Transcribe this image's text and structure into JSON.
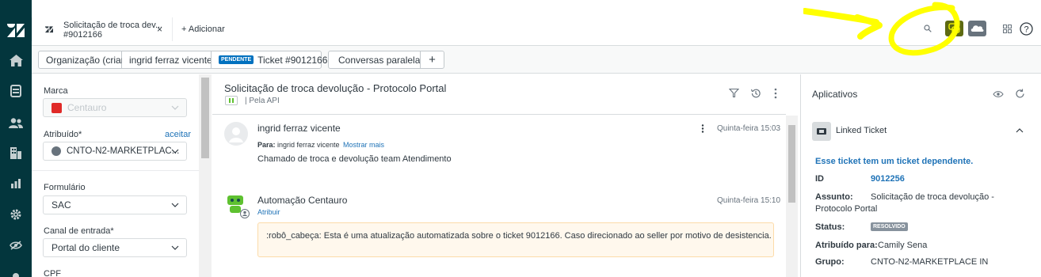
{
  "top_bar": {
    "tab": {
      "title": "Solicitação de troca dev...",
      "subtitle": "#9012166",
      "close": "×"
    },
    "add_label": "Adicionar"
  },
  "breadcrumbs": {
    "organization": "Organização (criar)",
    "requester": "ingrid ferraz vicente",
    "status_badge": "PENDENTE",
    "ticket": "Ticket #9012166",
    "side_conversations": "Conversas paralelas",
    "add": "+"
  },
  "left_panel": {
    "brand_label": "Marca",
    "brand_value": "Centauro",
    "assignee_label": "Atribuído*",
    "assignee_action": "aceitar",
    "assignee_value": "CNTO-N2-MARKETPLAC...",
    "form_label": "Formulário",
    "form_value": "SAC",
    "channel_label": "Canal de entrada*",
    "channel_value": "Portal do cliente",
    "cpf_label": "CPF"
  },
  "conversation": {
    "subject": "Solicitação de troca devolução - Protocolo Portal",
    "via": "Pela API",
    "messages": [
      {
        "author": "ingrid ferraz vicente",
        "time": "Quinta-feira 15:03",
        "to_label": "Para:",
        "to_value": "ingrid ferraz vicente",
        "show_more": "Mostrar mais",
        "body": "Chamado de troca e devolução team Atendimento"
      },
      {
        "author": "Automação Centauro",
        "time": "Quinta-feira 15:10",
        "action": "Atribuir",
        "body": ":robô_cabeça: Esta é uma atualização automatizada sobre o ticket 9012166. Caso direcionado ao seller por motivo de desistencia."
      }
    ]
  },
  "apps_panel": {
    "title": "Aplicativos",
    "app_name": "Linked Ticket",
    "dependent_note": "Esse ticket tem um ticket dependente.",
    "id_label": "ID",
    "id_value": "9012256",
    "subject_label": "Assunto:",
    "subject_value_1": "Solicitação de troca devolução -",
    "subject_value_2": "Protocolo Portal",
    "status_label": "Status:",
    "status_value": "RESOLVIDO",
    "assigned_label": "Atribuído para:",
    "assigned_value": "Camily Sena",
    "group_label": "Grupo:",
    "group_value": "CNTO-N2-MARKETPLACE IN"
  },
  "colors": {
    "nav_bg": "#03363d",
    "pending_badge": "#0071bf",
    "link": "#1f73b7",
    "annotation": "#ffff00",
    "resolved_badge": "#87929d",
    "bot_green": "#5ec130"
  },
  "icons": [
    "zendesk-logo-icon",
    "home-icon",
    "views-icon",
    "customers-icon",
    "organizations-icon",
    "reporting-icon",
    "admin-gear-icon",
    "eye-icon",
    "search-icon",
    "chat-icon",
    "cloud-icon",
    "apps-grid-icon",
    "help-icon",
    "filter-icon",
    "history-icon",
    "more-vertical-icon",
    "avatar-icon",
    "bot-icon",
    "chevron-down-icon",
    "chevron-up-icon",
    "refresh-icon",
    "linked-ticket-icon"
  ]
}
